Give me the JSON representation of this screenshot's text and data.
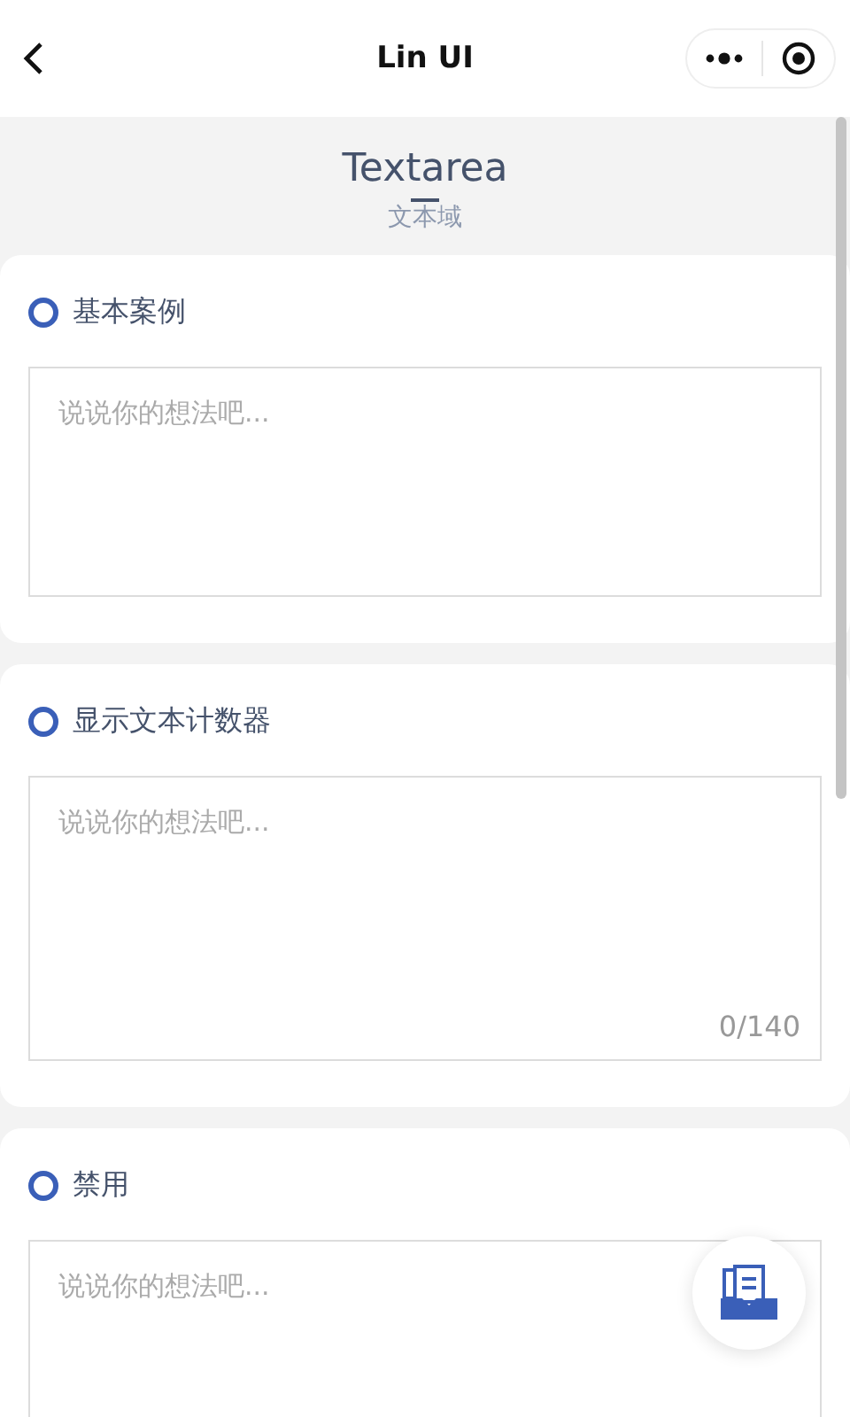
{
  "nav": {
    "title": "Lin UI"
  },
  "header": {
    "title": "Textarea",
    "subtitle": "文本域"
  },
  "sections": [
    {
      "title": "基本案例",
      "placeholder": "说说你的想法吧...",
      "kind": "plain"
    },
    {
      "title": "显示文本计数器",
      "placeholder": "说说你的想法吧...",
      "kind": "counter",
      "counter": "0/140"
    },
    {
      "title": "禁用",
      "placeholder": "说说你的想法吧...",
      "kind": "plain"
    }
  ]
}
